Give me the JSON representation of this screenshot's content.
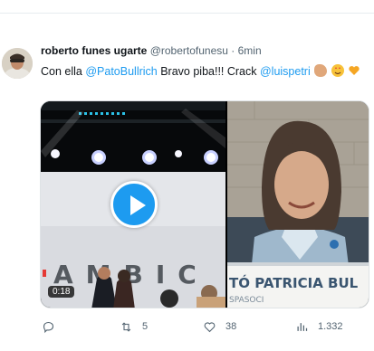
{
  "tweet": {
    "author_name": "roberto funes ugarte",
    "author_handle": "@robertofunesu",
    "separator": "·",
    "time": "6min",
    "text_prefix": "Con ella ",
    "mention_1": "@PatoBullrich",
    "text_middle": " Bravo piba!!! Crack ",
    "mention_2": "@luispetri",
    "emojis": [
      "flexed-biceps",
      "star-struck",
      "orange-heart"
    ]
  },
  "media": {
    "video_duration": "0:18",
    "video_sign_text": "AMBIC",
    "photo_sign_text": "TÓ PATRICIA BUL",
    "photo_sign_subtext": "SPASOCI"
  },
  "actions": {
    "reply_count": "",
    "retweet_count": "5",
    "like_count": "38",
    "views_count": "1.332"
  },
  "colors": {
    "accent": "#1d9bf0",
    "text": "#0f1419",
    "muted": "#536471"
  }
}
